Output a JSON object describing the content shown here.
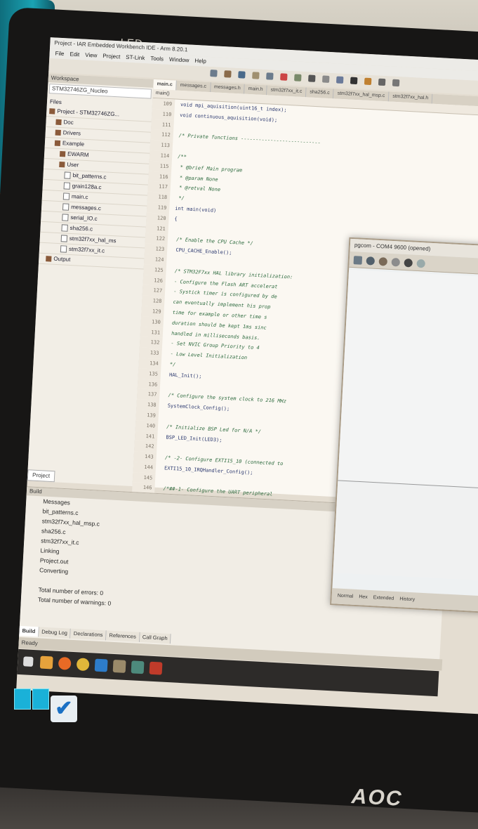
{
  "monitor": {
    "brand_top": "LED",
    "brand_bottom": "AOC"
  },
  "ide": {
    "title": "Project - IAR Embedded Workbench IDE - Arm 8.20.1",
    "menu": [
      "File",
      "Edit",
      "View",
      "Project",
      "ST-Link",
      "Tools",
      "Window",
      "Help"
    ],
    "workspace": {
      "title": "Workspace",
      "config": "STM32746ZG_Nucleo",
      "files_header": "Files",
      "tree": [
        {
          "label": "Project - STM32746ZG...",
          "icon": "project"
        },
        {
          "label": "Doc",
          "icon": "folder"
        },
        {
          "label": "Drivers",
          "icon": "folder"
        },
        {
          "label": "Example",
          "icon": "folder"
        },
        {
          "label": "EWARM",
          "icon": "folder"
        },
        {
          "label": "User",
          "icon": "folder"
        },
        {
          "label": "bit_patterns.c",
          "icon": "file"
        },
        {
          "label": "grain128a.c",
          "icon": "file"
        },
        {
          "label": "main.c",
          "icon": "file"
        },
        {
          "label": "messages.c",
          "icon": "file"
        },
        {
          "label": "serial_IO.c",
          "icon": "file"
        },
        {
          "label": "sha256.c",
          "icon": "file"
        },
        {
          "label": "stm32f7xx_hal_ms",
          "icon": "file"
        },
        {
          "label": "stm32f7xx_it.c",
          "icon": "file"
        },
        {
          "label": "Output",
          "icon": "folder"
        }
      ],
      "tab": "Project"
    },
    "editor": {
      "tabs": [
        "main.c",
        "messages.c",
        "messages.h",
        "main.h",
        "stm32f7xx_it.c",
        "sha256.c",
        "stm32f7xx_hal_msp.c",
        "stm32f7xx_hal.h"
      ],
      "function_bar": "main()",
      "lines": [
        {
          "n": "109",
          "text": "void mpi_aquisition(uint16_t index);",
          "comment": false
        },
        {
          "n": "110",
          "text": "void continuous_aquisition(void);",
          "comment": false
        },
        {
          "n": "111",
          "text": "",
          "comment": false
        },
        {
          "n": "112",
          "text": "/* Private functions ---------------------------",
          "comment": true
        },
        {
          "n": "113",
          "text": "",
          "comment": false
        },
        {
          "n": "114",
          "text": "/**",
          "comment": true
        },
        {
          "n": "115",
          "text": "  * @brief  Main program",
          "comment": true
        },
        {
          "n": "116",
          "text": "  * @param  None",
          "comment": true
        },
        {
          "n": "117",
          "text": "  * @retval None",
          "comment": true
        },
        {
          "n": "118",
          "text": "  */",
          "comment": true
        },
        {
          "n": "119",
          "text": "int main(void)",
          "comment": false
        },
        {
          "n": "120",
          "text": "{",
          "comment": false
        },
        {
          "n": "121",
          "text": "",
          "comment": false
        },
        {
          "n": "122",
          "text": "  /* Enable the CPU Cache */",
          "comment": true
        },
        {
          "n": "123",
          "text": "  CPU_CACHE_Enable();",
          "comment": false
        },
        {
          "n": "124",
          "text": "",
          "comment": false
        },
        {
          "n": "125",
          "text": "  /* STM32F7xx HAL library initialization:",
          "comment": true
        },
        {
          "n": "126",
          "text": "       - Configure the Flash ART accelerat",
          "comment": true
        },
        {
          "n": "127",
          "text": "       - Systick timer is configured by de",
          "comment": true
        },
        {
          "n": "128",
          "text": "         can eventually implement his prop",
          "comment": true
        },
        {
          "n": "129",
          "text": "         time for example or other time s",
          "comment": true
        },
        {
          "n": "130",
          "text": "         duration should be kept 1ms sinc",
          "comment": true
        },
        {
          "n": "131",
          "text": "         handled in milliseconds basis.",
          "comment": true
        },
        {
          "n": "132",
          "text": "       - Set NVIC Group Priority to 4",
          "comment": true
        },
        {
          "n": "133",
          "text": "       - Low Level Initialization",
          "comment": true
        },
        {
          "n": "134",
          "text": "     */",
          "comment": true
        },
        {
          "n": "135",
          "text": "  HAL_Init();",
          "comment": false
        },
        {
          "n": "136",
          "text": "",
          "comment": false
        },
        {
          "n": "137",
          "text": "  /* Configure the system clock to 216 MHz",
          "comment": true
        },
        {
          "n": "138",
          "text": "  SystemClock_Config();",
          "comment": false
        },
        {
          "n": "139",
          "text": "",
          "comment": false
        },
        {
          "n": "140",
          "text": "  /* Initialize BSP Led for N/A */",
          "comment": true
        },
        {
          "n": "141",
          "text": "  BSP_LED_Init(LED3);",
          "comment": false
        },
        {
          "n": "142",
          "text": "",
          "comment": false
        },
        {
          "n": "143",
          "text": "  /* -2- Configure EXTI15_10 (connected to",
          "comment": true
        },
        {
          "n": "144",
          "text": "  EXTI15_10_IRQHandler_Config();",
          "comment": false
        },
        {
          "n": "145",
          "text": "",
          "comment": false
        },
        {
          "n": "146",
          "text": "  /*##-1- Configure the UART peripheral",
          "comment": true
        }
      ]
    },
    "build": {
      "title": "Build",
      "messages": [
        "Messages",
        "bit_patterns.c",
        "stm32f7xx_hal_msp.c",
        "sha256.c",
        "stm32f7xx_it.c",
        "Linking",
        "Project.out",
        "Converting",
        "",
        "Total number of errors: 0",
        "Total number of warnings: 0"
      ],
      "tabs": [
        "Build",
        "Debug Log",
        "Declarations",
        "References",
        "Call Graph"
      ],
      "status": "Ready"
    },
    "popup": {
      "title": "pgcom - COM4 9600 (opened)",
      "status": [
        "Normal",
        "Hex",
        "Extended",
        "History"
      ]
    }
  },
  "colors": {
    "accent_teal": "#1aa3b3",
    "orange": "#e09a48",
    "screen_bg": "#e4ddd1"
  }
}
